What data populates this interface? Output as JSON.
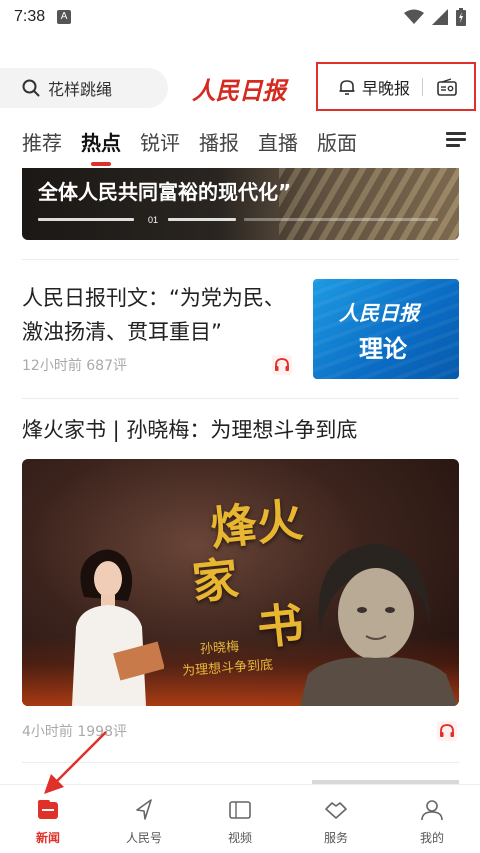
{
  "status_bar": {
    "time": "7:38",
    "notification_badge": "A"
  },
  "header": {
    "search_placeholder": "花样跳绳",
    "logo_text": "人民日报",
    "brief_label": "早晚报"
  },
  "tabs": {
    "items": [
      "推荐",
      "热点",
      "锐评",
      "播报",
      "直播",
      "版面"
    ],
    "active_index": 1
  },
  "banner": {
    "title": "全体人民共同富裕的现代化”",
    "page_indicator": "01"
  },
  "articles": [
    {
      "title": "人民日报刊文：“为党为民、激浊扬清、贯耳重目”",
      "meta": "12小时前  687评",
      "thumb_brand": "人民日报",
      "thumb_word": "理论"
    },
    {
      "title": "烽火家书 | 孙晓梅：为理想斗争到底",
      "image_title_lines": [
        "烽火",
        "家",
        "书"
      ],
      "image_subtitle_1": "孙晓梅",
      "image_subtitle_2": "为理想斗争到底",
      "meta": "4小时前  1998评"
    }
  ],
  "bottom_nav": {
    "items": [
      "新闻",
      "人民号",
      "视频",
      "服务",
      "我的"
    ],
    "active_index": 0
  },
  "colors": {
    "accent": "#e0302a",
    "thumb_blue": "#1e9be3",
    "poster_gold": "#e8b630"
  }
}
